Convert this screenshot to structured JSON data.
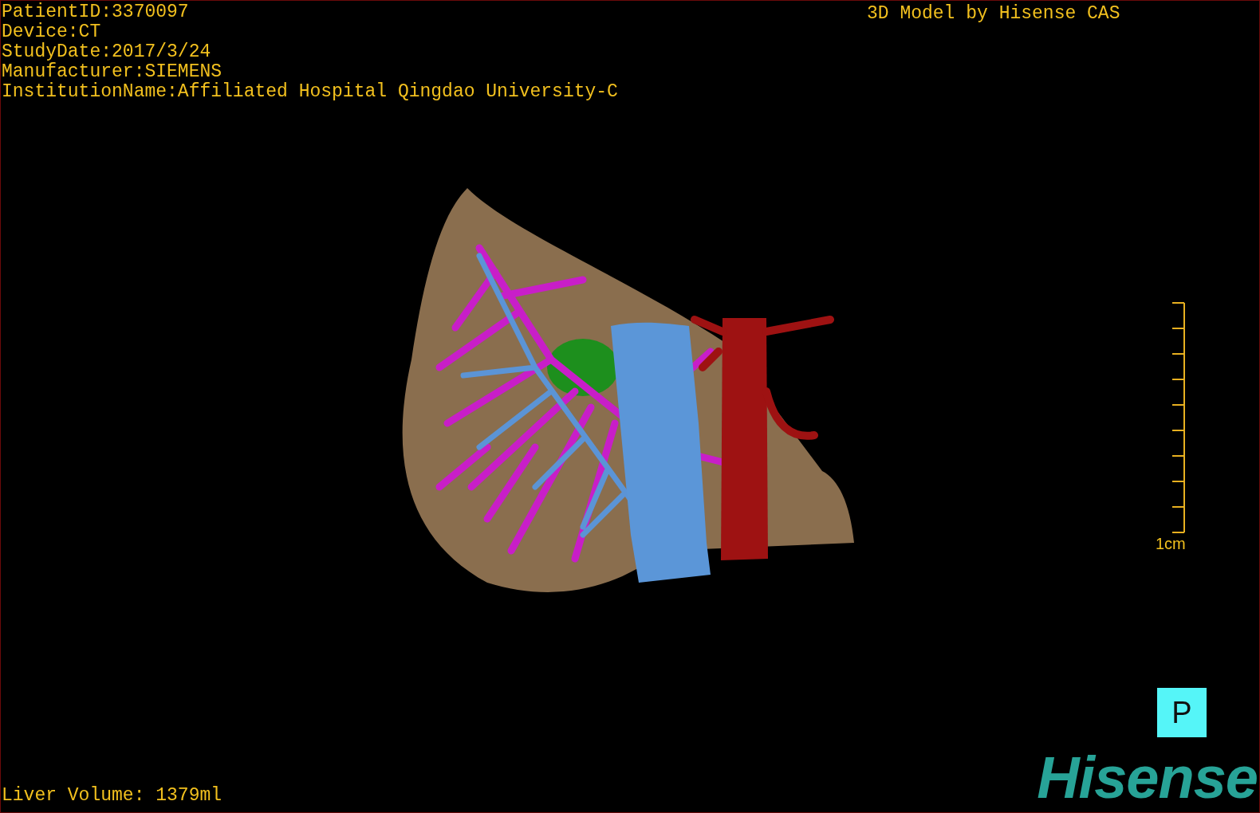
{
  "patient_info": [
    "PatientID:3370097",
    "Device:CT",
    "StudyDate:2017/3/24",
    "Manufacturer:SIEMENS",
    "InstitutionName:Affiliated Hospital Qingdao University-C"
  ],
  "model_credit": "3D Model by Hisense CAS",
  "scale_bar": {
    "label": "1cm"
  },
  "orientation_marker": "P",
  "liver_volume": "Liver Volume: 1379ml",
  "logo": "Hisense"
}
